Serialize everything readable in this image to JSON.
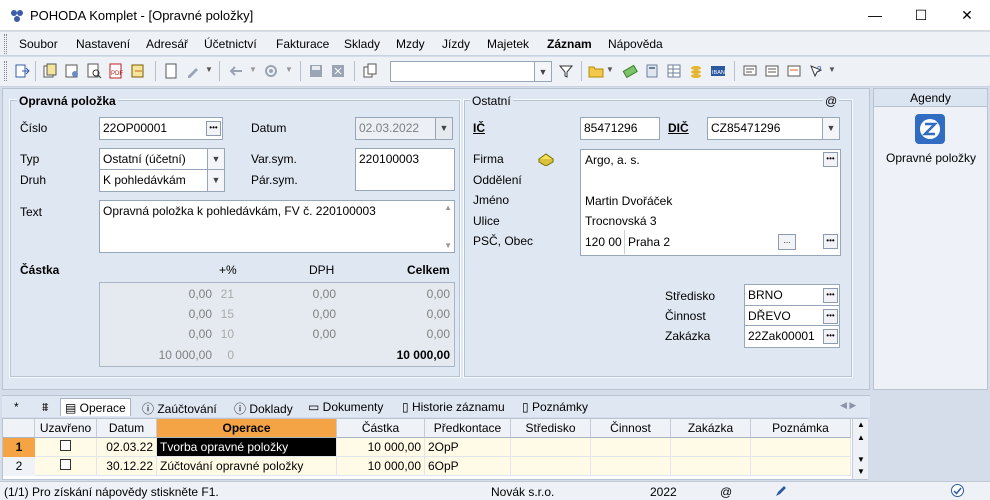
{
  "window": {
    "title": "POHODA Komplet - [Opravné položky]",
    "minimize": "—",
    "maximize": "☐",
    "close": "✕"
  },
  "menu": [
    "Soubor",
    "Nastavení",
    "Adresář",
    "Účetnictví",
    "Fakturace",
    "Sklady",
    "Mzdy",
    "Jízdy",
    "Majetek",
    "Záznam",
    "Nápověda"
  ],
  "form": {
    "section_title": "Opravná položka",
    "cislo_label": "Číslo",
    "cislo_value": "22OP00001",
    "datum_label": "Datum",
    "datum_value": "02.03.2022",
    "typ_label": "Typ",
    "typ_value": "Ostatní (účetní)",
    "druh_label": "Druh",
    "druh_value": "K pohledávkám",
    "varsym_label": "Var.sym.",
    "varsym_value": "220100003",
    "parsym_label": "Pár.sym.",
    "text_label": "Text",
    "text_value": "Opravná položka k pohledávkám, FV č. 220100003",
    "castka_label": "Částka",
    "pct_label": "+%",
    "dph_label": "DPH",
    "celkem_label": "Celkem",
    "amount_rows": [
      {
        "base": "0,00",
        "pct": "21",
        "dph": "0,00",
        "total": "0,00"
      },
      {
        "base": "0,00",
        "pct": "15",
        "dph": "0,00",
        "total": "0,00"
      },
      {
        "base": "0,00",
        "pct": "10",
        "dph": "0,00",
        "total": "0,00"
      },
      {
        "base": "10 000,00",
        "pct": "0",
        "dph": "",
        "total": "10 000,00"
      }
    ]
  },
  "ostatni": {
    "title": "Ostatní",
    "at": "@",
    "ic_label": "IČ",
    "ic_value": "85471296",
    "dic_label": "DIČ",
    "dic_value": "CZ85471296",
    "firma_label": "Firma",
    "firma_value": "Argo, a. s.",
    "oddeleni_label": "Oddělení",
    "jmeno_label": "Jméno",
    "jmeno_value": "Martin Dvořáček",
    "ulice_label": "Ulice",
    "ulice_value": "Trocnovská 3",
    "psc_label": "PSČ, Obec",
    "psc_value": "120 00",
    "obec_value": "Praha 2",
    "ellipsis": "...",
    "stredisko_label": "Středisko",
    "stredisko_value": "BRNO",
    "cinnost_label": "Činnost",
    "cinnost_value": "DŘEVO",
    "zakazka_label": "Zakázka",
    "zakazka_value": "22Zak00001"
  },
  "agendy": {
    "header": "Agendy",
    "item": "Opravné položky"
  },
  "tabs": [
    "Operace",
    "Zaúčtování",
    "Doklady",
    "Dokumenty",
    "Historie záznamu",
    "Poznámky"
  ],
  "tabs_star": "*",
  "grid": {
    "columns": [
      "Uzavřeno",
      "Datum",
      "Operace",
      "Částka",
      "Předkontace",
      "Středisko",
      "Činnost",
      "Zakázka",
      "Poznámka"
    ],
    "rows": [
      {
        "n": "1",
        "datum": "02.03.22",
        "operace": "Tvorba opravné položky",
        "castka": "10 000,00",
        "predkontace": "2OpP"
      },
      {
        "n": "2",
        "datum": "30.12.22",
        "operace": "Zúčtování opravné položky",
        "castka": "10 000,00",
        "predkontace": "6OpP"
      }
    ]
  },
  "status": {
    "help": "(1/1) Pro získání nápovědy stiskněte F1.",
    "company": "Novák s.r.o.",
    "year": "2022",
    "at": "@"
  },
  "colors": {
    "accent": "#f4a445",
    "selected_row": "#000000",
    "row_alt": "#fffbe6"
  }
}
